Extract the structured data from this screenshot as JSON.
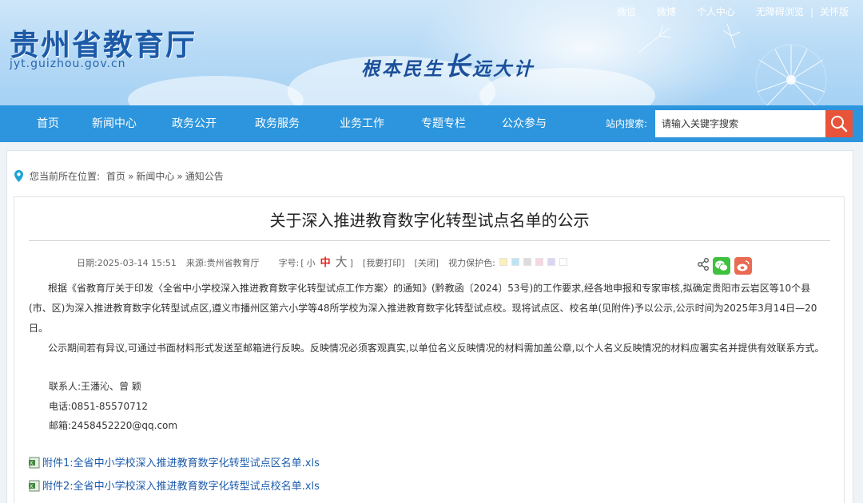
{
  "header": {
    "site_title": "贵州省教育厅",
    "domain": "jyt.guizhou.gov.cn",
    "slogan_part1": "根本民生",
    "slogan_big": "长",
    "slogan_part2": "远大计",
    "top_links": [
      "微信",
      "微博",
      "个人中心",
      "无障碍浏览",
      "|",
      "关怀版"
    ]
  },
  "nav": {
    "items": [
      "首页",
      "新闻中心",
      "政务公开",
      "政务服务",
      "业务工作",
      "专题专栏",
      "公众参与"
    ],
    "search_label": "站内搜索:",
    "search_placeholder": "请输入关键字搜索",
    "search_icon": "search-icon"
  },
  "breadcrumb": {
    "prefix": "您当前所在位置:",
    "items": [
      "首页",
      "新闻中心",
      "通知公告"
    ],
    "separator": "»"
  },
  "article": {
    "title": "关于深入推进教育数字化转型试点名单的公示",
    "meta": {
      "date_label": "日期:",
      "date": "2025-03-14 15:51",
      "source_label": "来源:",
      "source": "贵州省教育厅",
      "font_label": "字号:",
      "bracket_open": "[",
      "bracket_close": "]",
      "font_small": "小",
      "font_mid": "中",
      "font_big": "大",
      "print": "[我要打印]",
      "close": "[关闭]",
      "eye_label": "视力保护色:",
      "swatches": [
        "#faf1b9",
        "#bde4f6",
        "#dcdcdc",
        "#f8d6e0",
        "#dcd4f3",
        "#ffffff"
      ]
    },
    "paragraphs": [
      "根据《省教育厅关于印发〈全省中小学校深入推进教育数字化转型试点工作方案〉的通知》(黔教函〔2024〕53号)的工作要求,经各地申报和专家审核,拟确定贵阳市云岩区等10个县(市、区)为深入推进教育数字化转型试点区,遵义市播州区第六小学等48所学校为深入推进教育数字化转型试点校。现将试点区、校名单(见附件)予以公示,公示时间为2025年3月14日—20日。",
      "公示期间若有异议,可通过书面材料形式发送至邮箱进行反映。反映情况必须客观真实,以单位名义反映情况的材料需加盖公章,以个人名义反映情况的材料应署实名并提供有效联系方式。"
    ],
    "contact": {
      "person": "联系人:王潘沁、曾 颖",
      "phone": "电话:0851-85570712",
      "email": "邮箱:2458452220@qq.com"
    },
    "attachments": [
      "附件1:全省中小学校深入推进教育数字化转型试点区名单.xls",
      "附件2:全省中小学校深入推进教育数字化转型试点校名单.xls"
    ]
  },
  "colors": {
    "nav_bg": "#2c95dd",
    "search_btn": "#e8543a",
    "title_blue": "#1c5aa8",
    "link_blue": "#1d5cad",
    "font_mid_red": "#e2231a"
  }
}
